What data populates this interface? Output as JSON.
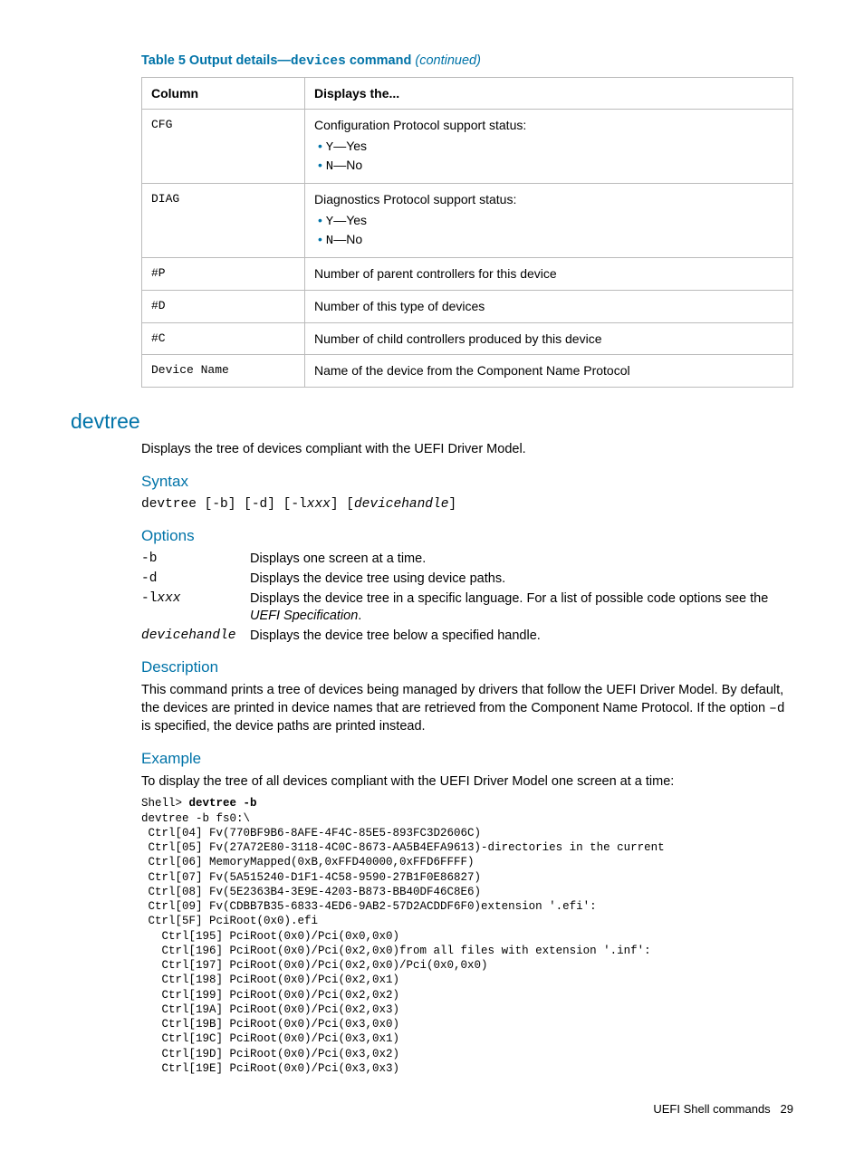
{
  "table": {
    "caption_prefix": "Table 5 Output details—",
    "caption_cmd": "devices",
    "caption_suffix": " command ",
    "caption_cont": "(continued)",
    "headers": [
      "Column",
      "Displays the..."
    ],
    "rows": [
      {
        "col": "CFG",
        "desc": "Configuration Protocol support status:",
        "items": [
          "Y—Yes",
          "N—No"
        ]
      },
      {
        "col": "DIAG",
        "desc": "Diagnostics Protocol support status:",
        "items": [
          "Y—Yes",
          "N—No"
        ]
      },
      {
        "col": "#P",
        "desc": "Number of parent controllers for this device"
      },
      {
        "col": "#D",
        "desc": "Number of this type of devices"
      },
      {
        "col": "#C",
        "desc": "Number of child controllers produced by this device"
      },
      {
        "col": "Device Name",
        "desc": "Name of the device from the Component Name Protocol"
      }
    ]
  },
  "section_title": "devtree",
  "intro": "Displays the tree of devices compliant with the UEFI Driver Model.",
  "syntax": {
    "heading": "Syntax",
    "cmd": "devtree",
    "parts": [
      "[-b]",
      "[-d]",
      "[-l",
      "xxx",
      "]",
      "[",
      "devicehandle",
      "]"
    ]
  },
  "options": {
    "heading": "Options",
    "items": [
      {
        "key": "-b",
        "desc": "Displays one screen at a time."
      },
      {
        "key": "-d",
        "desc": "Displays the device tree using device paths."
      },
      {
        "key": "-lxxx",
        "key_ital_from": 2,
        "desc_pre": "Displays the device tree in a specific language. For a list of possible code options see the ",
        "desc_ital": "UEFI Specification",
        "desc_post": "."
      },
      {
        "key": "devicehandle",
        "key_all_ital": true,
        "desc": "Displays the device tree below a specified handle."
      }
    ]
  },
  "description": {
    "heading": "Description",
    "text_pre": "This command prints a tree of devices being managed by drivers that follow the UEFI Driver Model. By default, the devices are printed in device names that are retrieved from the Component Name Protocol. If the option ",
    "opt": "–d",
    "text_post": " is specified, the device paths are printed instead."
  },
  "example": {
    "heading": "Example",
    "intro": "To display the tree of all devices compliant with the UEFI Driver Model one screen at a time:",
    "prompt": "Shell> ",
    "cmd": "devtree -b",
    "lines": [
      "devtree -b fs0:\\",
      " Ctrl[04] Fv(770BF9B6-8AFE-4F4C-85E5-893FC3D2606C)",
      " Ctrl[05] Fv(27A72E80-3118-4C0C-8673-AA5B4EFA9613)-directories in the current",
      " Ctrl[06] MemoryMapped(0xB,0xFFD40000,0xFFD6FFFF)",
      " Ctrl[07] Fv(5A515240-D1F1-4C58-9590-27B1F0E86827)",
      " Ctrl[08] Fv(5E2363B4-3E9E-4203-B873-BB40DF46C8E6)",
      " Ctrl[09] Fv(CDBB7B35-6833-4ED6-9AB2-57D2ACDDF6F0)extension '.efi':",
      " Ctrl[5F] PciRoot(0x0).efi",
      "   Ctrl[195] PciRoot(0x0)/Pci(0x0,0x0)",
      "   Ctrl[196] PciRoot(0x0)/Pci(0x2,0x0)from all files with extension '.inf':",
      "   Ctrl[197] PciRoot(0x0)/Pci(0x2,0x0)/Pci(0x0,0x0)",
      "   Ctrl[198] PciRoot(0x0)/Pci(0x2,0x1)",
      "   Ctrl[199] PciRoot(0x0)/Pci(0x2,0x2)",
      "   Ctrl[19A] PciRoot(0x0)/Pci(0x2,0x3)",
      "   Ctrl[19B] PciRoot(0x0)/Pci(0x3,0x0)",
      "   Ctrl[19C] PciRoot(0x0)/Pci(0x3,0x1)",
      "   Ctrl[19D] PciRoot(0x0)/Pci(0x3,0x2)",
      "   Ctrl[19E] PciRoot(0x0)/Pci(0x3,0x3)"
    ]
  },
  "footer": {
    "text": "UEFI Shell commands",
    "page": "29"
  }
}
